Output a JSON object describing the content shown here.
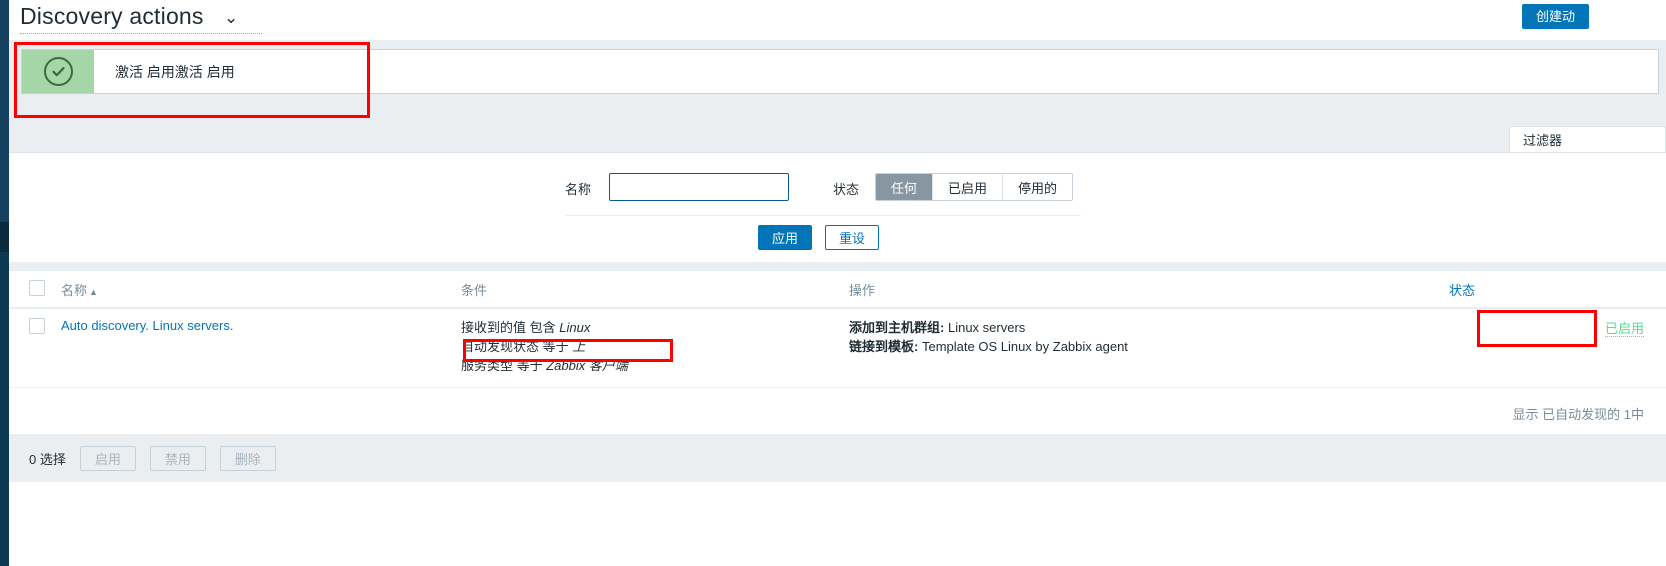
{
  "header": {
    "title": "Discovery actions",
    "chevron": "chevron-down",
    "create_button": "创建动"
  },
  "message": {
    "icon": "check-circle",
    "text": "激活 启用激活 启用"
  },
  "filter": {
    "tab_label": "过滤器",
    "name_label": "名称",
    "name_value": "",
    "name_placeholder": "",
    "status_label": "状态",
    "status_options": [
      "任何",
      "已启用",
      "停用的"
    ],
    "status_selected": "任何",
    "apply_label": "应用",
    "reset_label": "重设"
  },
  "table": {
    "columns": {
      "name": "名称",
      "sort_arrow": "▲",
      "conditions": "条件",
      "operations": "操作",
      "status": "状态"
    },
    "rows": [
      {
        "name": "Auto discovery. Linux servers.",
        "conditions": [
          {
            "label": "接收到的值 包含 ",
            "value": "Linux"
          },
          {
            "label": "自动发现状态 等于 ",
            "value": "上"
          },
          {
            "label": "服务类型 等于 ",
            "value": "Zabbix 客户端"
          }
        ],
        "operations": [
          {
            "label": "添加到主机群组:",
            "value": "Linux servers"
          },
          {
            "label": "链接到模板:",
            "value": "Template OS Linux by Zabbix agent"
          }
        ],
        "status": "已启用"
      }
    ]
  },
  "footer": {
    "count_text": "显示 已自动发现的 1中"
  },
  "action_bar": {
    "selected_text": "0 选择",
    "buttons": [
      "启用",
      "禁用",
      "删除"
    ]
  },
  "colors": {
    "accent": "#0275b8",
    "success_bg": "#a5d6a7",
    "status_enabled": "#59db8f",
    "annotation": "#ff0000",
    "panel_bg": "#ebeef0",
    "sidebar": "#0e3d5c"
  }
}
